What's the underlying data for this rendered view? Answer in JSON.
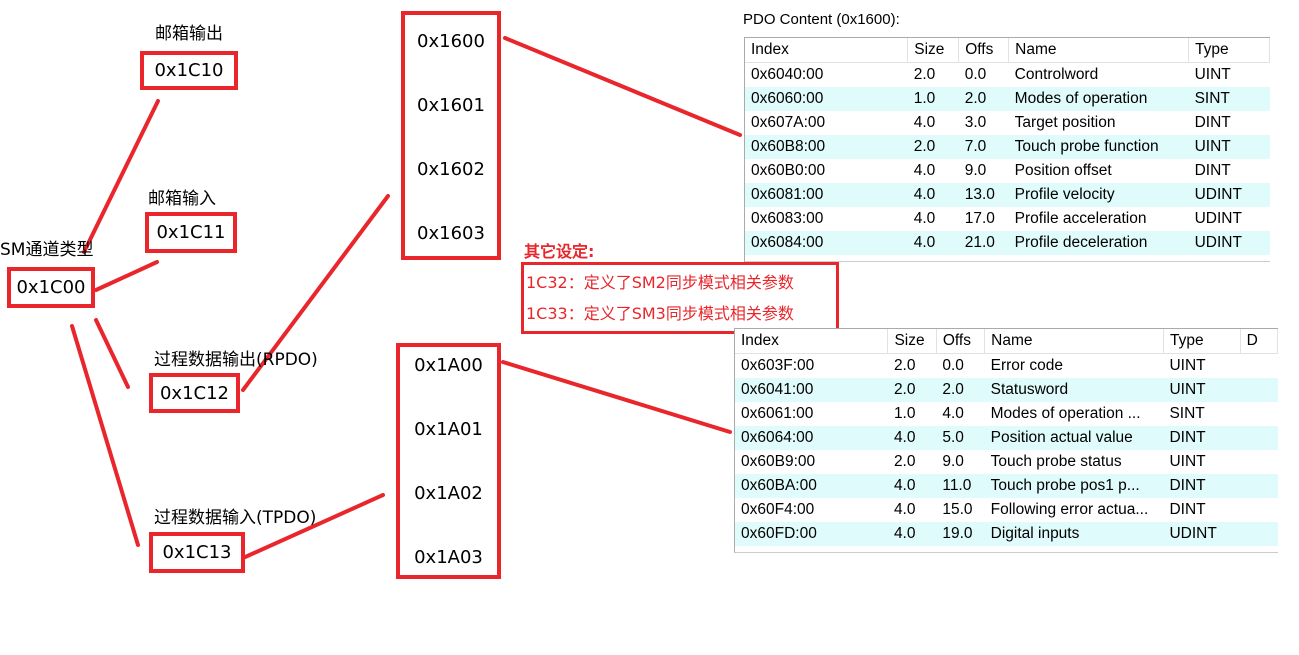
{
  "colors": {
    "accent": "#e8262b",
    "row_highlight": "#e0fbfb"
  },
  "sm": {
    "type_label": "SM通道类型",
    "type_box": "0x1C00",
    "items": [
      {
        "label": "邮箱输出",
        "box": "0x1C10"
      },
      {
        "label": "邮箱输入",
        "box": "0x1C11"
      },
      {
        "label": "过程数据输出(RPDO)",
        "box": "0x1C12"
      },
      {
        "label": "过程数据输入(TPDO)",
        "box": "0x1C13"
      }
    ]
  },
  "rpdo_column": [
    "0x1600",
    "0x1601",
    "0x1602",
    "0x1603"
  ],
  "tpdo_column": [
    "0x1A00",
    "0x1A01",
    "0x1A02",
    "0x1A03"
  ],
  "other": {
    "title": "其它设定:",
    "lines": [
      "1C32：定义了SM2同步模式相关参数",
      "1C33：定义了SM3同步模式相关参数"
    ]
  },
  "rpdo_table": {
    "title": "PDO Content (0x1600):",
    "headers": [
      "Index",
      "Size",
      "Offs",
      "Name",
      "Type"
    ],
    "rows": [
      [
        "0x6040:00",
        "2.0",
        "0.0",
        "Controlword",
        "UINT"
      ],
      [
        "0x6060:00",
        "1.0",
        "2.0",
        "Modes of operation",
        "SINT"
      ],
      [
        "0x607A:00",
        "4.0",
        "3.0",
        "Target position",
        "DINT"
      ],
      [
        "0x60B8:00",
        "2.0",
        "7.0",
        "Touch probe function",
        "UINT"
      ],
      [
        "0x60B0:00",
        "4.0",
        "9.0",
        "Position offset",
        "DINT"
      ],
      [
        "0x6081:00",
        "4.0",
        "13.0",
        "Profile velocity",
        "UDINT"
      ],
      [
        "0x6083:00",
        "4.0",
        "17.0",
        "Profile acceleration",
        "UDINT"
      ],
      [
        "0x6084:00",
        "4.0",
        "21.0",
        "Profile deceleration",
        "UDINT"
      ]
    ]
  },
  "tpdo_table": {
    "headers": [
      "Index",
      "Size",
      "Offs",
      "Name",
      "Type",
      "D"
    ],
    "rows": [
      [
        "0x603F:00",
        "2.0",
        "0.0",
        "Error code",
        "UINT"
      ],
      [
        "0x6041:00",
        "2.0",
        "2.0",
        "Statusword",
        "UINT"
      ],
      [
        "0x6061:00",
        "1.0",
        "4.0",
        "Modes of operation ...",
        "SINT"
      ],
      [
        "0x6064:00",
        "4.0",
        "5.0",
        "Position actual value",
        "DINT"
      ],
      [
        "0x60B9:00",
        "2.0",
        "9.0",
        "Touch probe status",
        "UINT"
      ],
      [
        "0x60BA:00",
        "4.0",
        "11.0",
        "Touch probe pos1 p...",
        "DINT"
      ],
      [
        "0x60F4:00",
        "4.0",
        "15.0",
        "Following error actua...",
        "DINT"
      ],
      [
        "0x60FD:00",
        "4.0",
        "19.0",
        "Digital inputs",
        "UDINT"
      ]
    ]
  }
}
